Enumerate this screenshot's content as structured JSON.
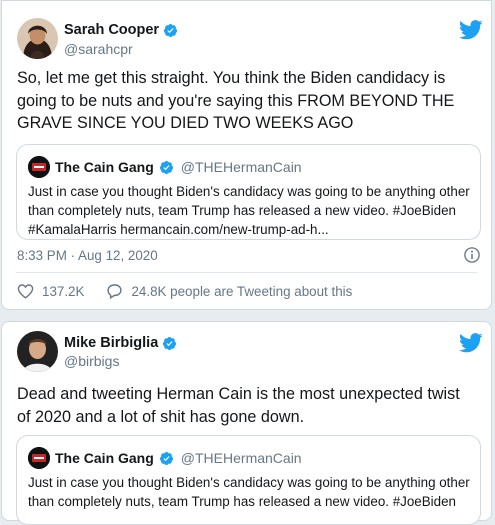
{
  "tweet1": {
    "author_name": "Sarah Cooper",
    "author_handle": "@sarahcpr",
    "text": "So, let me get this straight. You think the Biden candidacy is going to be nuts and you're saying this FROM BEYOND THE GRAVE SINCE YOU DIED TWO WEEKS AGO",
    "quote": {
      "name": "The Cain Gang",
      "handle": "@THEHermanCain",
      "text": "Just in case you thought Biden's candidacy was going to be anything other than completely nuts, team Trump has released a new video. #JoeBiden #KamalaHarris hermancain.com/new-trump-ad-h..."
    },
    "timestamp": "8:33 PM · Aug 12, 2020",
    "likes": "137.2K",
    "conversation": "24.8K people are Tweeting about this"
  },
  "tweet2": {
    "author_name": "Mike Birbiglia",
    "author_handle": "@birbigs",
    "text": "Dead and tweeting Herman Cain is the most unexpected twist of 2020 and a lot of shit has gone down.",
    "quote": {
      "name": "The Cain Gang",
      "handle": "@THEHermanCain",
      "text": "Just in case you thought Biden's candidacy was going to be anything other than completely nuts, team Trump has released a new video. #JoeBiden"
    }
  },
  "colors": {
    "twitter_blue": "#1da1f2",
    "secondary_text": "#657786",
    "border": "#cfd9de"
  }
}
